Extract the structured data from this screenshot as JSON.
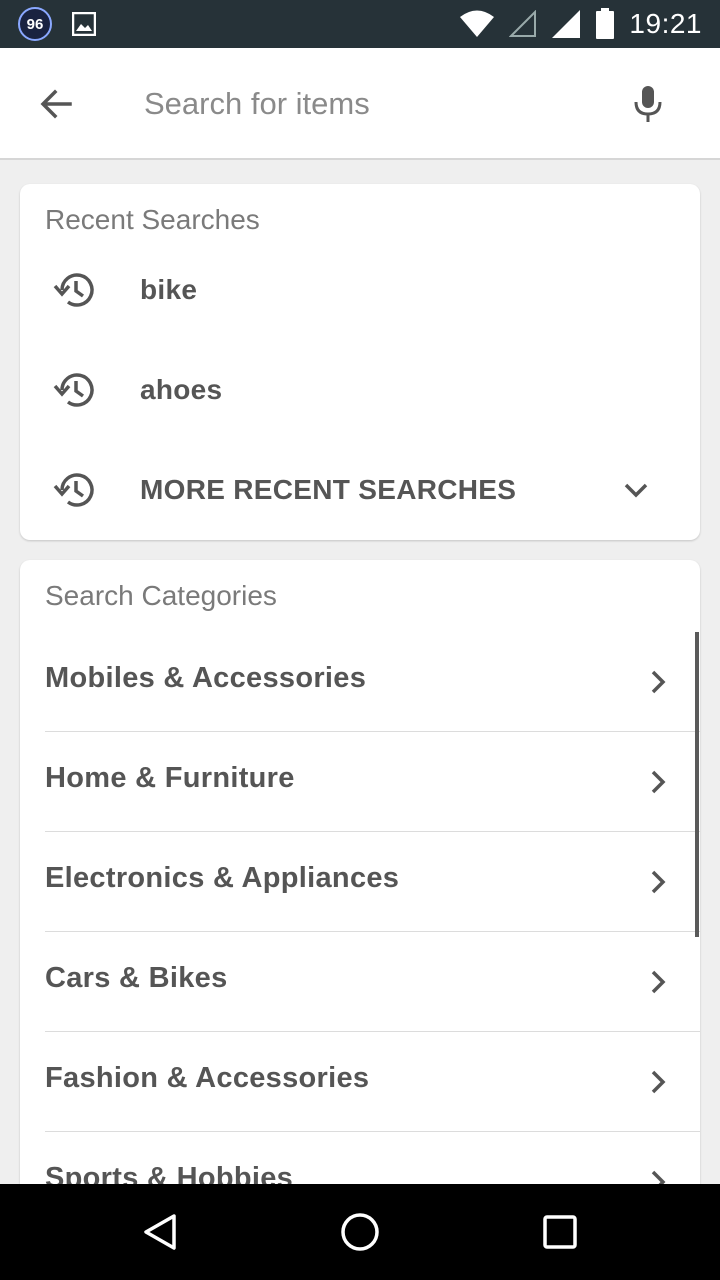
{
  "status_bar": {
    "badge": "96",
    "time": "19:21",
    "icons": [
      "notification-badge-icon",
      "image-icon",
      "wifi-icon",
      "signal-icon",
      "battery-icon"
    ]
  },
  "search": {
    "placeholder": "Search for items",
    "value": "",
    "back_icon": "arrow-back-icon",
    "mic_icon": "microphone-icon"
  },
  "recent": {
    "title": "Recent Searches",
    "items": [
      {
        "label": "bike",
        "icon": "history-icon"
      },
      {
        "label": "ahoes",
        "icon": "history-icon"
      }
    ],
    "more_label": "MORE RECENT SEARCHES"
  },
  "categories": {
    "title": "Search Categories",
    "items": [
      {
        "label": "Mobiles & Accessories"
      },
      {
        "label": "Home & Furniture"
      },
      {
        "label": "Electronics & Appliances"
      },
      {
        "label": "Cars & Bikes"
      },
      {
        "label": "Fashion & Accessories"
      },
      {
        "label": "Sports & Hobbies"
      }
    ]
  },
  "nav_bar": {
    "buttons": [
      "back-triangle-icon",
      "home-circle-icon",
      "recents-square-icon"
    ]
  },
  "colors": {
    "status_bar": "#263238",
    "card": "#ffffff",
    "background": "#efefef",
    "text_primary": "#555555",
    "text_secondary": "#7a7a7a"
  }
}
